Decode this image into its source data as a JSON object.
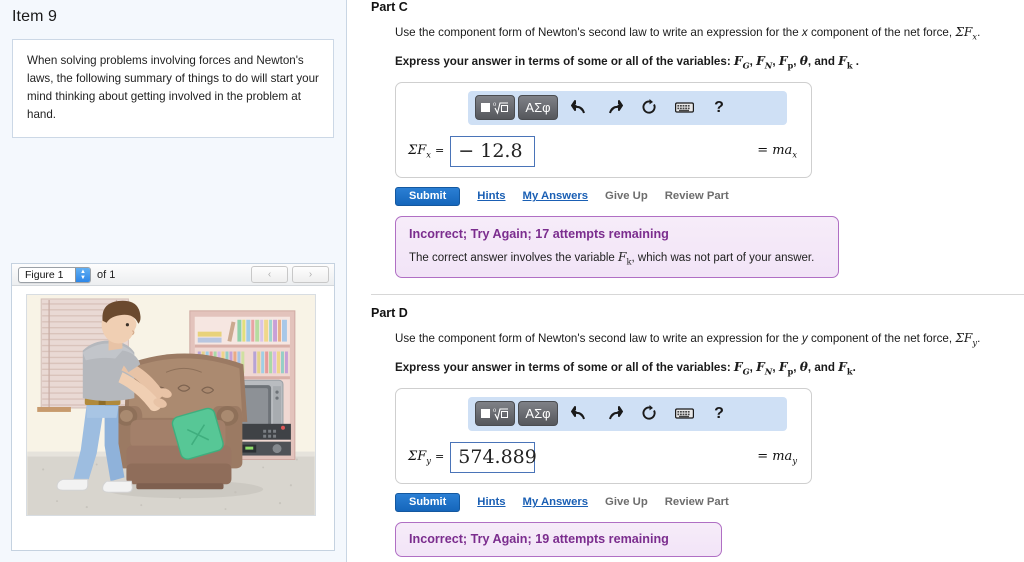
{
  "sidebar": {
    "item_title": "Item 9",
    "intro_text": "When solving problems involving forces and Newton's laws, the following summary of things to do will start your mind thinking about getting involved in the problem at hand.",
    "figure": {
      "selected": "Figure 1",
      "of_label": "of 1",
      "prev_icon": "‹",
      "next_icon": "›",
      "alt": "Illustration of a man pushing a brown upholstered armchair with a green pillow across a carpeted living room with a bookshelf and television"
    }
  },
  "toolbar": {
    "template_label": "√",
    "greek_label": "ΑΣφ",
    "undo_icon": "undo-arrow",
    "redo_icon": "redo-arrow",
    "reset_icon": "reset-arrow",
    "keyboard_icon": "keyboard",
    "help_label": "?"
  },
  "actions": {
    "submit_label": "Submit",
    "hints_label": "Hints",
    "my_answers_label": "My Answers",
    "give_up_label": "Give Up",
    "review_part_label": "Review Part"
  },
  "parts": [
    {
      "heading": "Part C",
      "question_prefix": "Use the component form of Newton's second law to write an expression for the ",
      "question_component": "x",
      "question_middle": " component of the net force, ",
      "question_symbol": "ΣF",
      "question_symbol_sub": "x",
      "question_suffix": ".",
      "express_prefix": "Express your answer in terms of some or all of the variables: ",
      "variables": [
        "F_G",
        "F_N",
        "F_p",
        "θ",
        "F_k"
      ],
      "express_suffix": " .",
      "lhs_symbol": "ΣF",
      "lhs_sub": "x",
      "lhs_equals": "=",
      "answer_value": "− 12.8",
      "rhs": "= ma",
      "rhs_sub": "x",
      "feedback_title": "Incorrect; Try Again; 17 attempts remaining",
      "feedback_body_prefix": "The correct answer involves the variable ",
      "feedback_body_var": "F",
      "feedback_body_var_sub": "k",
      "feedback_body_suffix": ", which was not part of your answer."
    },
    {
      "heading": "Part D",
      "question_prefix": "Use the component form of Newton's second law to write an expression for the ",
      "question_component": "y",
      "question_middle": " component of the net force, ",
      "question_symbol": "ΣF",
      "question_symbol_sub": "y",
      "question_suffix": ".",
      "express_prefix": "Express your answer in terms of some or all of the variables: ",
      "variables": [
        "F_G",
        "F_N",
        "F_p",
        "θ",
        "F_k"
      ],
      "express_suffix": ".",
      "lhs_symbol": "ΣF",
      "lhs_sub": "y",
      "lhs_equals": "=",
      "answer_value": "574.889",
      "rhs": "= ma",
      "rhs_sub": "y",
      "feedback_title": "Incorrect; Try Again; 19 attempts remaining",
      "feedback_body_prefix": "",
      "feedback_body_var": "",
      "feedback_body_var_sub": "",
      "feedback_body_suffix": ""
    }
  ],
  "colors": {
    "sidebar_bg": "#f4f8fd",
    "submit_blue": "#1566bb",
    "link_blue": "#1a5fb4",
    "feedback_border": "#b06fc4",
    "feedback_title": "#7b2d8e",
    "mathbar_bg": "#cfe0f5",
    "input_border": "#4a74b8"
  }
}
